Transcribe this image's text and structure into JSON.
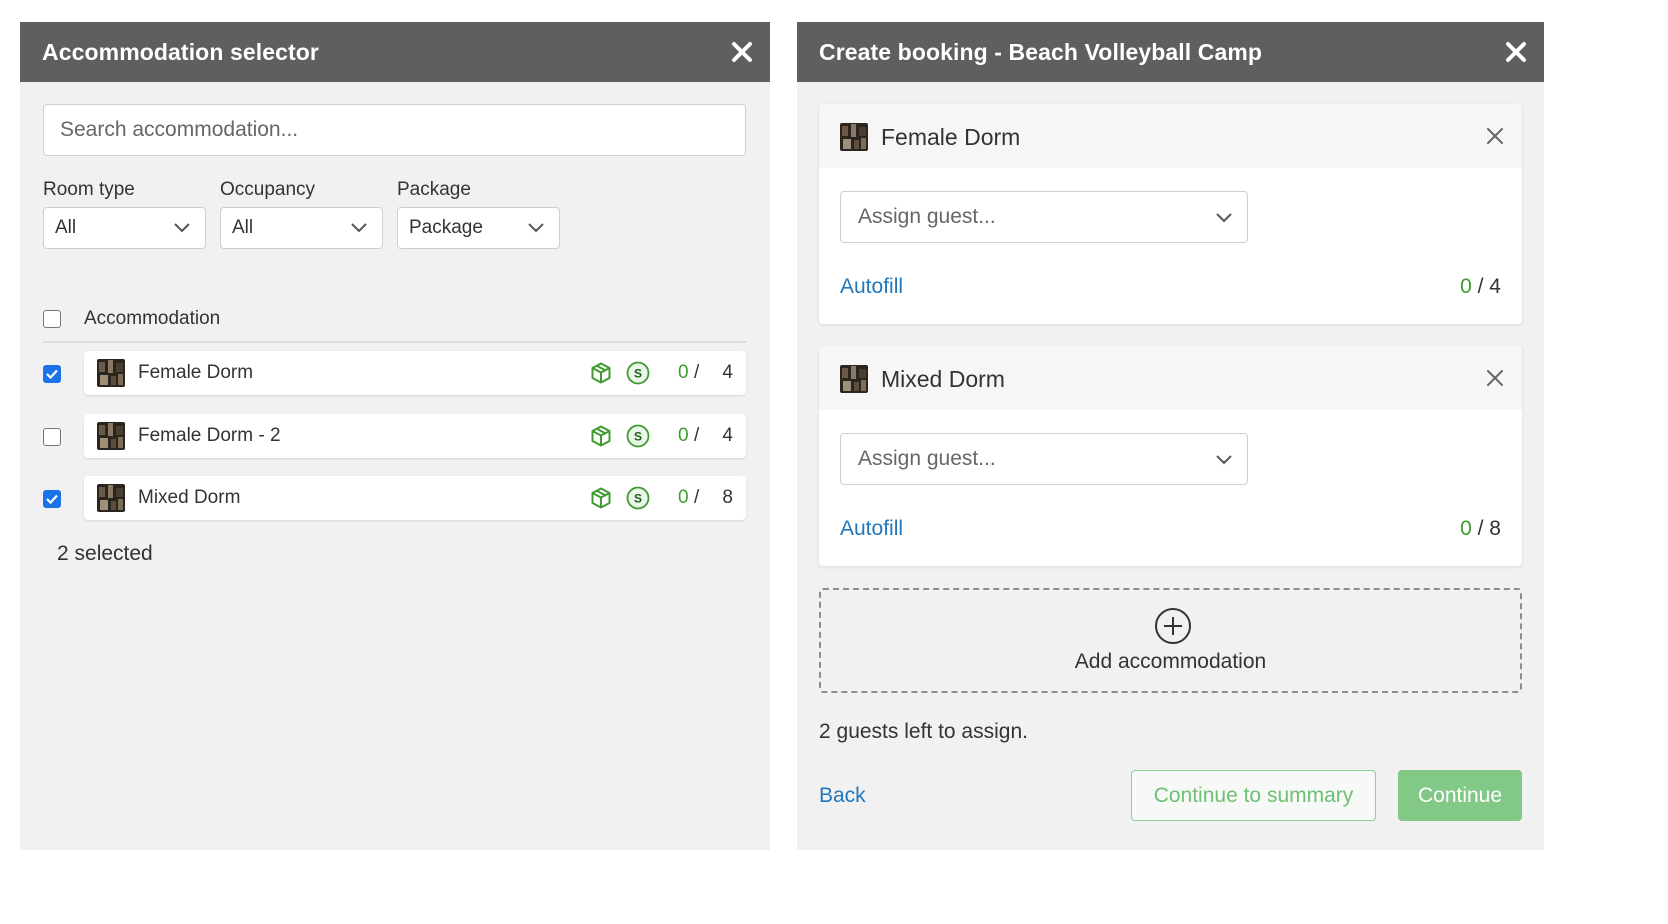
{
  "selector": {
    "title": "Accommodation selector",
    "search": {
      "placeholder": "Search accommodation...",
      "value": ""
    },
    "filters": [
      {
        "label": "Room type",
        "value": "All"
      },
      {
        "label": "Occupancy",
        "value": "All"
      },
      {
        "label": "Package",
        "value": "Package"
      }
    ],
    "table_heading": "Accommodation",
    "rows": [
      {
        "name": "Female Dorm",
        "checked": true,
        "assigned": "0",
        "slash": "/",
        "capacity": "4"
      },
      {
        "name": "Female Dorm - 2",
        "checked": false,
        "assigned": "0",
        "slash": "/",
        "capacity": "4"
      },
      {
        "name": "Mixed Dorm",
        "checked": true,
        "assigned": "0",
        "slash": "/",
        "capacity": "8"
      }
    ],
    "selected_text": "2 selected"
  },
  "booking": {
    "title": "Create booking - Beach Volleyball Camp",
    "cards": [
      {
        "name": "Female Dorm",
        "assign_placeholder": "Assign guest...",
        "autofill": "Autofill",
        "assigned": "0",
        "capacity": "/ 4"
      },
      {
        "name": "Mixed Dorm",
        "assign_placeholder": "Assign guest...",
        "autofill": "Autofill",
        "assigned": "0",
        "capacity": "/ 8"
      }
    ],
    "add_label": "Add accommodation",
    "guests_left": "2 guests left to assign.",
    "back": "Back",
    "continue_summary": "Continue to summary",
    "continue": "Continue"
  },
  "icons": {
    "close": "close-icon",
    "chevron": "chevron-down-icon",
    "package": "package-icon",
    "price": "dollar-circle-icon",
    "add": "plus-circle-icon",
    "thumbnail": "room-thumbnail"
  },
  "colors": {
    "header_bg": "#5f5f5f",
    "panel_bg": "#f1f1f1",
    "checkbox_blue": "#1a73e8",
    "count_green": "#3f9b2f",
    "link_blue": "#2277bb",
    "button_green": "#82c886"
  }
}
